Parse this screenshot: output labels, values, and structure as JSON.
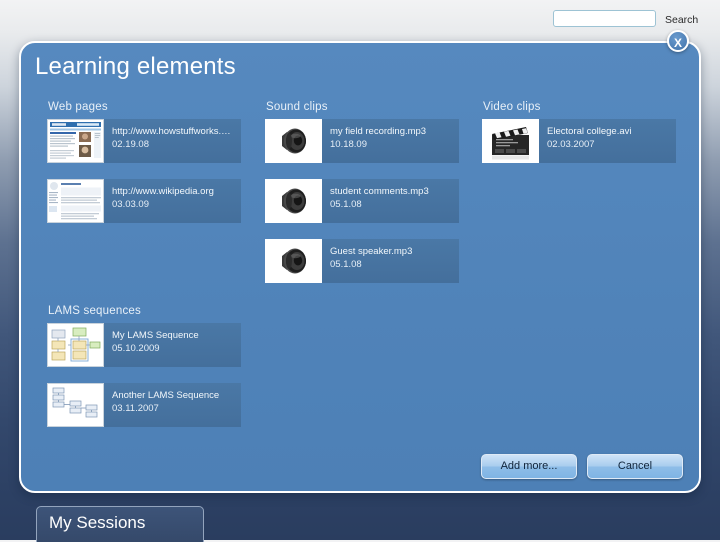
{
  "topbar": {
    "search_value": "",
    "search_placeholder": "",
    "search_label": "Search"
  },
  "dialog": {
    "title": "Learning elements",
    "close_label": "X",
    "buttons": {
      "add_more": "Add more...",
      "cancel": "Cancel"
    }
  },
  "sections": {
    "web_pages": {
      "title": "Web pages",
      "items": [
        {
          "name": "http://www.howstuffworks.com",
          "date": "02.19.08",
          "icon": "webpage-thumbnail"
        },
        {
          "name": "http://www.wikipedia.org",
          "date": "03.03.09",
          "icon": "webpage-thumbnail"
        }
      ]
    },
    "sound_clips": {
      "title": "Sound clips",
      "items": [
        {
          "name": "my field recording.mp3",
          "date": "10.18.09",
          "icon": "speaker-icon"
        },
        {
          "name": "student comments.mp3",
          "date": "05.1.08",
          "icon": "speaker-icon"
        },
        {
          "name": "Guest speaker.mp3",
          "date": "05.1.08",
          "icon": "speaker-icon"
        }
      ]
    },
    "video_clips": {
      "title": "Video clips",
      "items": [
        {
          "name": "Electoral college.avi",
          "date": "02.03.2007",
          "icon": "clapperboard-icon"
        }
      ]
    },
    "lams_sequences": {
      "title": "LAMS sequences",
      "items": [
        {
          "name": "My LAMS Sequence",
          "date": "05.10.2009",
          "icon": "flowchart-thumbnail"
        },
        {
          "name": "Another LAMS Sequence",
          "date": "03.11.2007",
          "icon": "flowchart-thumbnail"
        }
      ]
    }
  },
  "bottom_tab": {
    "label": "My Sessions"
  },
  "colors": {
    "panel_blue": "#5286bc",
    "item_blue": "#46749f",
    "background_top": "#f2f3f4",
    "background_bottom": "#2a3d5f",
    "button_blue": "#a9cdee",
    "tab_navy": "#35496a"
  }
}
